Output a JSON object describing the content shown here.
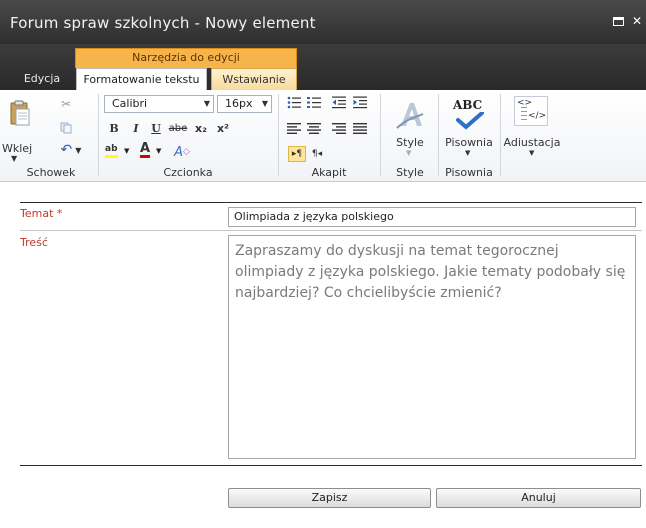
{
  "window": {
    "title": "Forum spraw szkolnych - Nowy element"
  },
  "ribbon": {
    "context_group": "Narzędzia do edycji",
    "tabs": [
      {
        "label": "Edycja"
      },
      {
        "label": "Formatowanie tekstu",
        "selected": true
      },
      {
        "label": "Wstawianie"
      }
    ],
    "groups": {
      "clipboard": {
        "label": "Schowek",
        "paste_label": "Wklej"
      },
      "font": {
        "label": "Czcionka",
        "font_name": "Calibri",
        "font_size": "16px"
      },
      "paragraph": {
        "label": "Akapit"
      },
      "styles": {
        "label": "Style",
        "button_label": "Style"
      },
      "spelling": {
        "label": "Pisownia",
        "button_label": "Pisownia"
      },
      "markup": {
        "button_label": "Adiustacja"
      }
    },
    "glyphs": {
      "bold": "B",
      "italic": "I",
      "underline": "U",
      "strike": "abe",
      "subscript": "x₂",
      "superscript": "x²",
      "highlight": "ab",
      "font_color": "A",
      "ltr": "▸¶",
      "rtl": "¶◂",
      "abc": "ABC"
    }
  },
  "form": {
    "title_field": {
      "label": "Temat",
      "required_marker": " *",
      "value": "Olimpiada z języka polskiego"
    },
    "body_field": {
      "label": "Treść",
      "value": "Zapraszamy do dyskusji na temat tegorocznej olimpiady z języka polskiego. Jakie tematy podobały się najbardziej? Co chcielibyście zmienić?"
    },
    "save_label": "Zapisz",
    "cancel_label": "Anuluj"
  },
  "colors": {
    "accent_orange": "#f7b44a",
    "titlebar": "#3a3a3a",
    "required": "#c0392b"
  }
}
